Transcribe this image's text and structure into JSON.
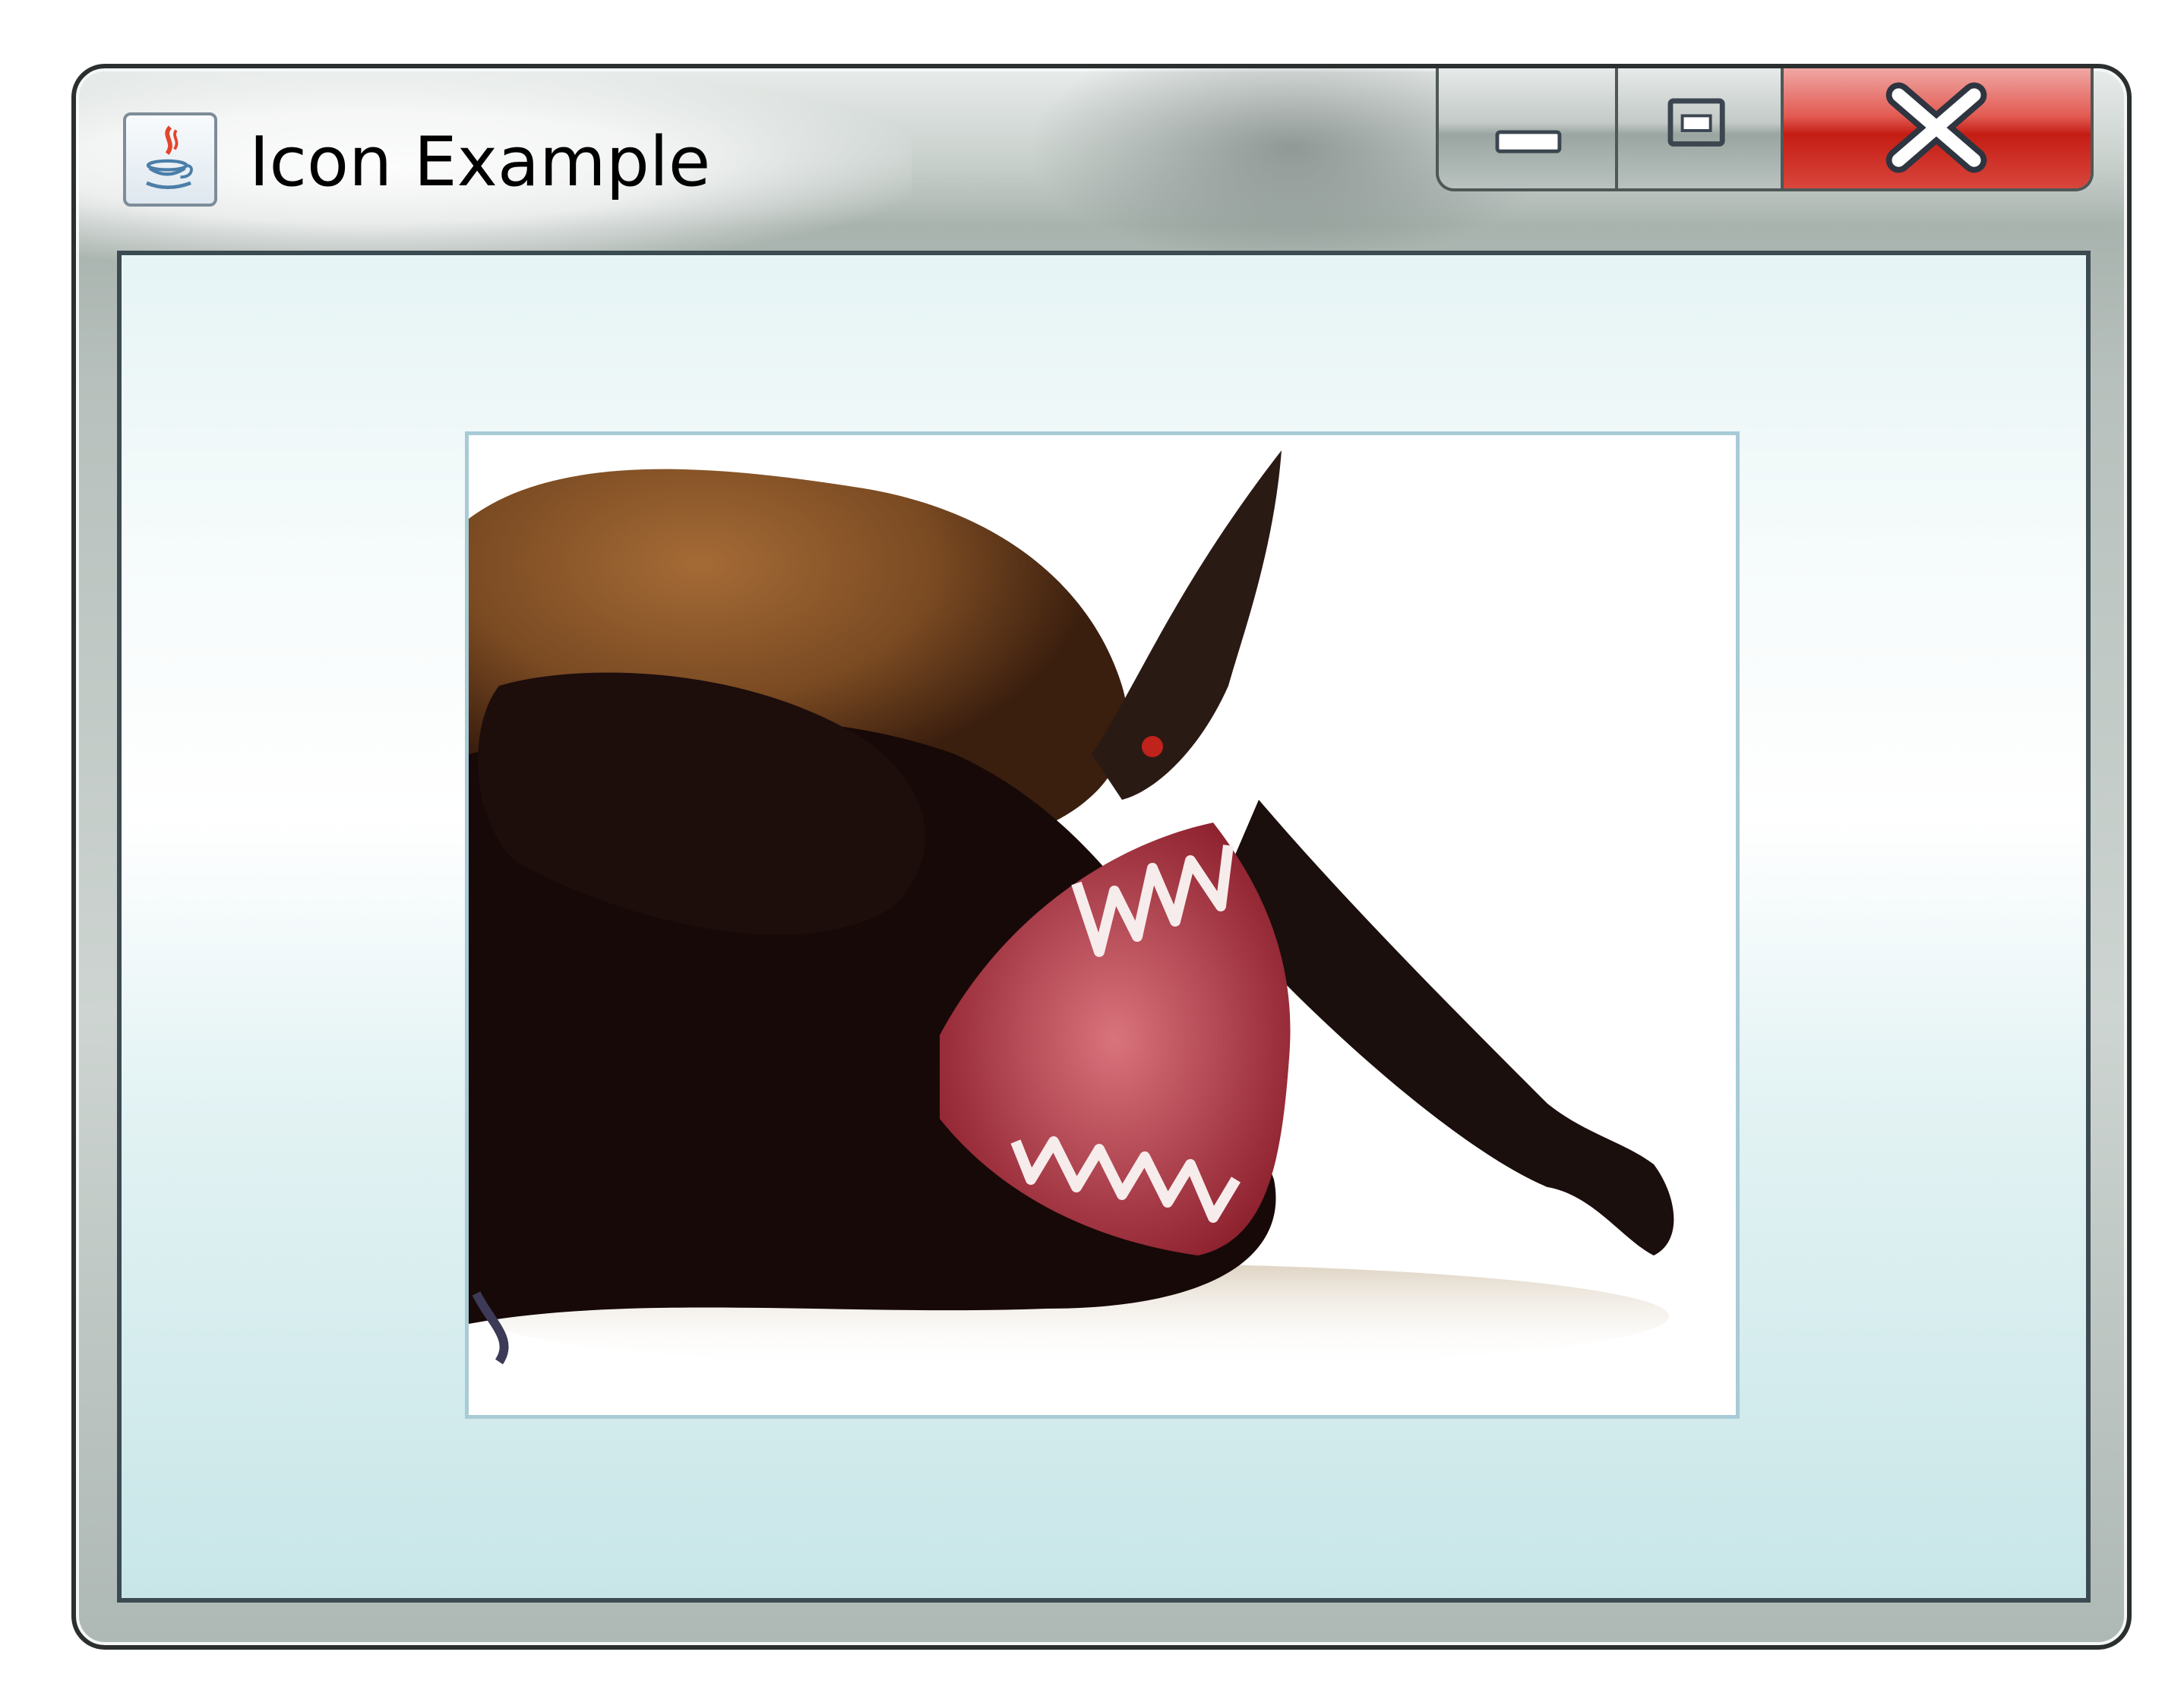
{
  "window": {
    "title": "Icon Example"
  },
  "title_bar": {
    "app_icon": "java-cup-icon",
    "buttons": [
      {
        "name": "minimize",
        "icon": "minimize-icon"
      },
      {
        "name": "maximize",
        "icon": "maximize-icon"
      },
      {
        "name": "close",
        "icon": "close-icon"
      }
    ]
  },
  "content": {
    "image_label": {
      "subject": "bat-photo-icon"
    }
  },
  "colors": {
    "close_button": "#c41d14",
    "client_area_top": "#e6f4f5",
    "client_area_bottom": "#c8e6e8",
    "image_border": "#a8cbd6"
  }
}
